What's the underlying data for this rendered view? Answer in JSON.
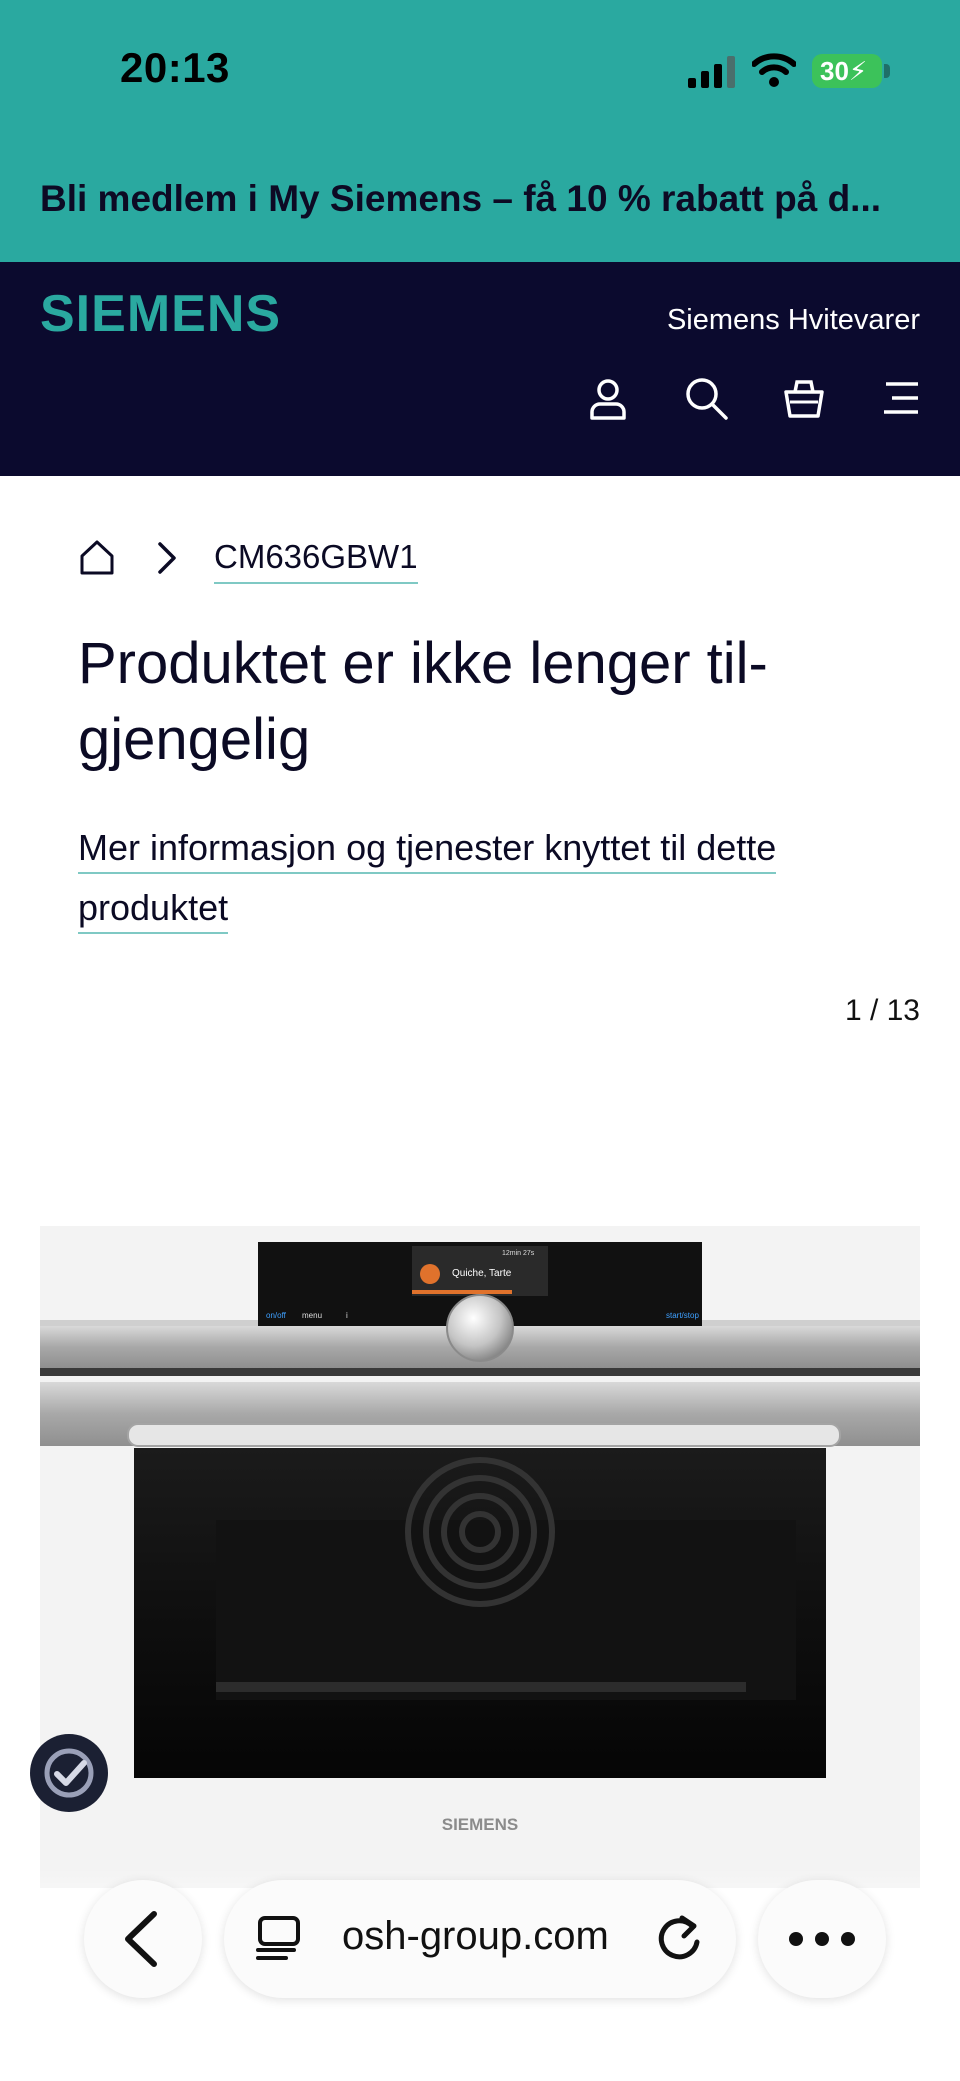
{
  "status_bar": {
    "time": "20:13",
    "battery": "30"
  },
  "promo": {
    "text": "Bli medlem i My Siemens – få 10 % rabatt på d..."
  },
  "header": {
    "logo": "SIEMENS",
    "brand_link": "Siemens Hvitevarer",
    "icons": [
      "user-icon",
      "search-icon",
      "basket-icon",
      "menu-icon"
    ]
  },
  "breadcrumb": {
    "model": "CM636GBW1"
  },
  "main": {
    "title": "Produktet er ikke lenger til-gjengelig",
    "more_info_link": "Mer informasjon og tjenester knyttet til dette produktet",
    "gallery_counter": "1 / 13"
  },
  "product_image": {
    "display_text": "Quiche, Tarte",
    "display_timer": "12min 27s",
    "buttons": [
      "on/off",
      "menu",
      "i",
      "start/stop"
    ],
    "brand_label": "SIEMENS"
  },
  "browser": {
    "url": "osh-group.com"
  },
  "colors": {
    "accent": "#2aa9a0",
    "header_bg": "#0b0a2e",
    "text": "#0b0a24"
  }
}
